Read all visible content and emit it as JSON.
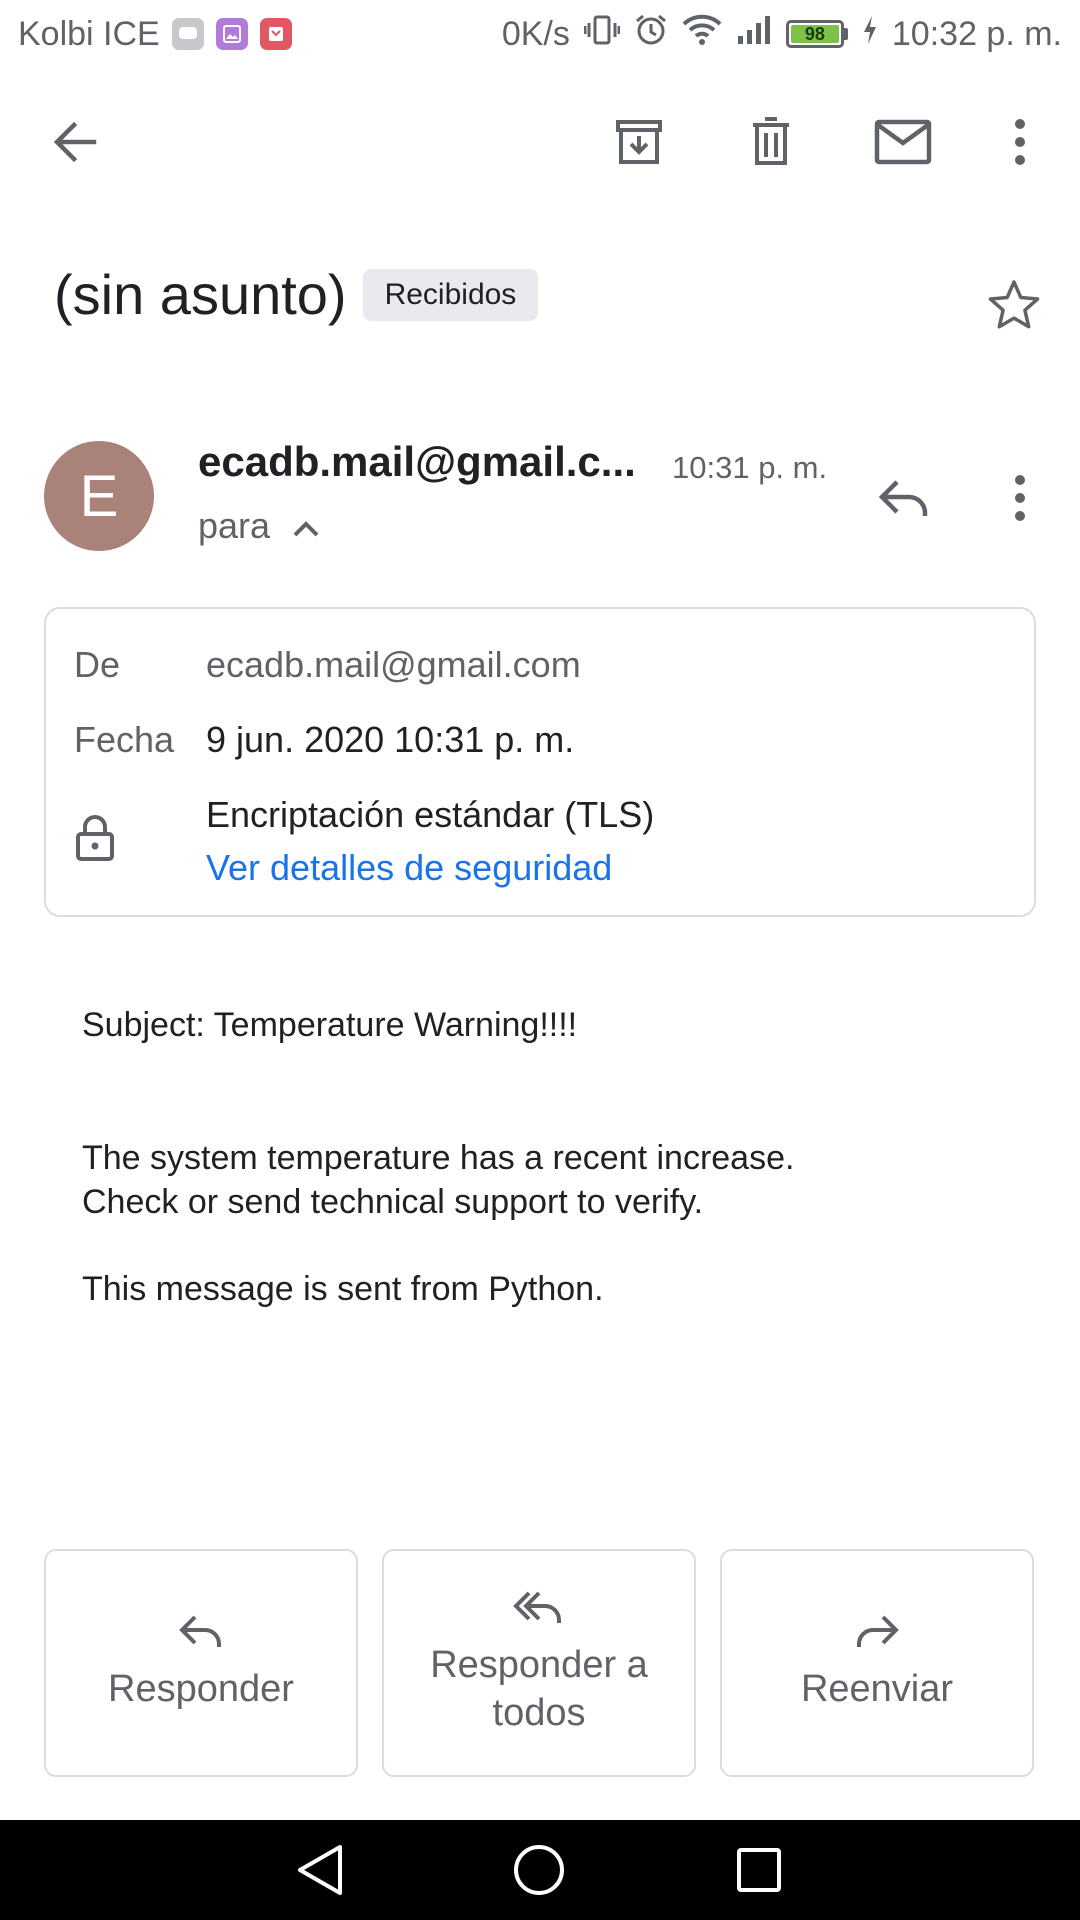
{
  "status_bar": {
    "carrier": "Kolbi ICE",
    "net_speed": "0K/s",
    "battery_level": "98",
    "time": "10:32 p. m."
  },
  "toolbar": {
    "icons": [
      "back-arrow-icon",
      "archive-icon",
      "trash-icon",
      "mail-icon",
      "more-vert-icon"
    ]
  },
  "email": {
    "subject": "(sin asunto)",
    "label": "Recibidos",
    "sender_avatar_letter": "E",
    "sender_display": "ecadb.mail@gmail.c...",
    "time": "10:31 p. m.",
    "to_label": "para"
  },
  "details": {
    "from_label": "De",
    "from_value": "ecadb.mail@gmail.com",
    "date_label": "Fecha",
    "date_value": "9 jun. 2020 10:31 p. m.",
    "encryption": "Encriptación estándar (TLS)",
    "security_link": "Ver detalles de seguridad"
  },
  "body": {
    "line1": "Subject: Temperature Warning!!!!",
    "para2": "The system temperature has a recent increase.\nCheck or send technical support to verify.",
    "para3": "This message is sent from Python."
  },
  "actions": {
    "reply": "Responder",
    "reply_all": "Responder a todos",
    "forward": "Reenviar"
  },
  "colors": {
    "avatar": "#a9827a",
    "link": "#1a73e8",
    "battery": "#7cc24a",
    "label_chip": "#e8eaed"
  }
}
